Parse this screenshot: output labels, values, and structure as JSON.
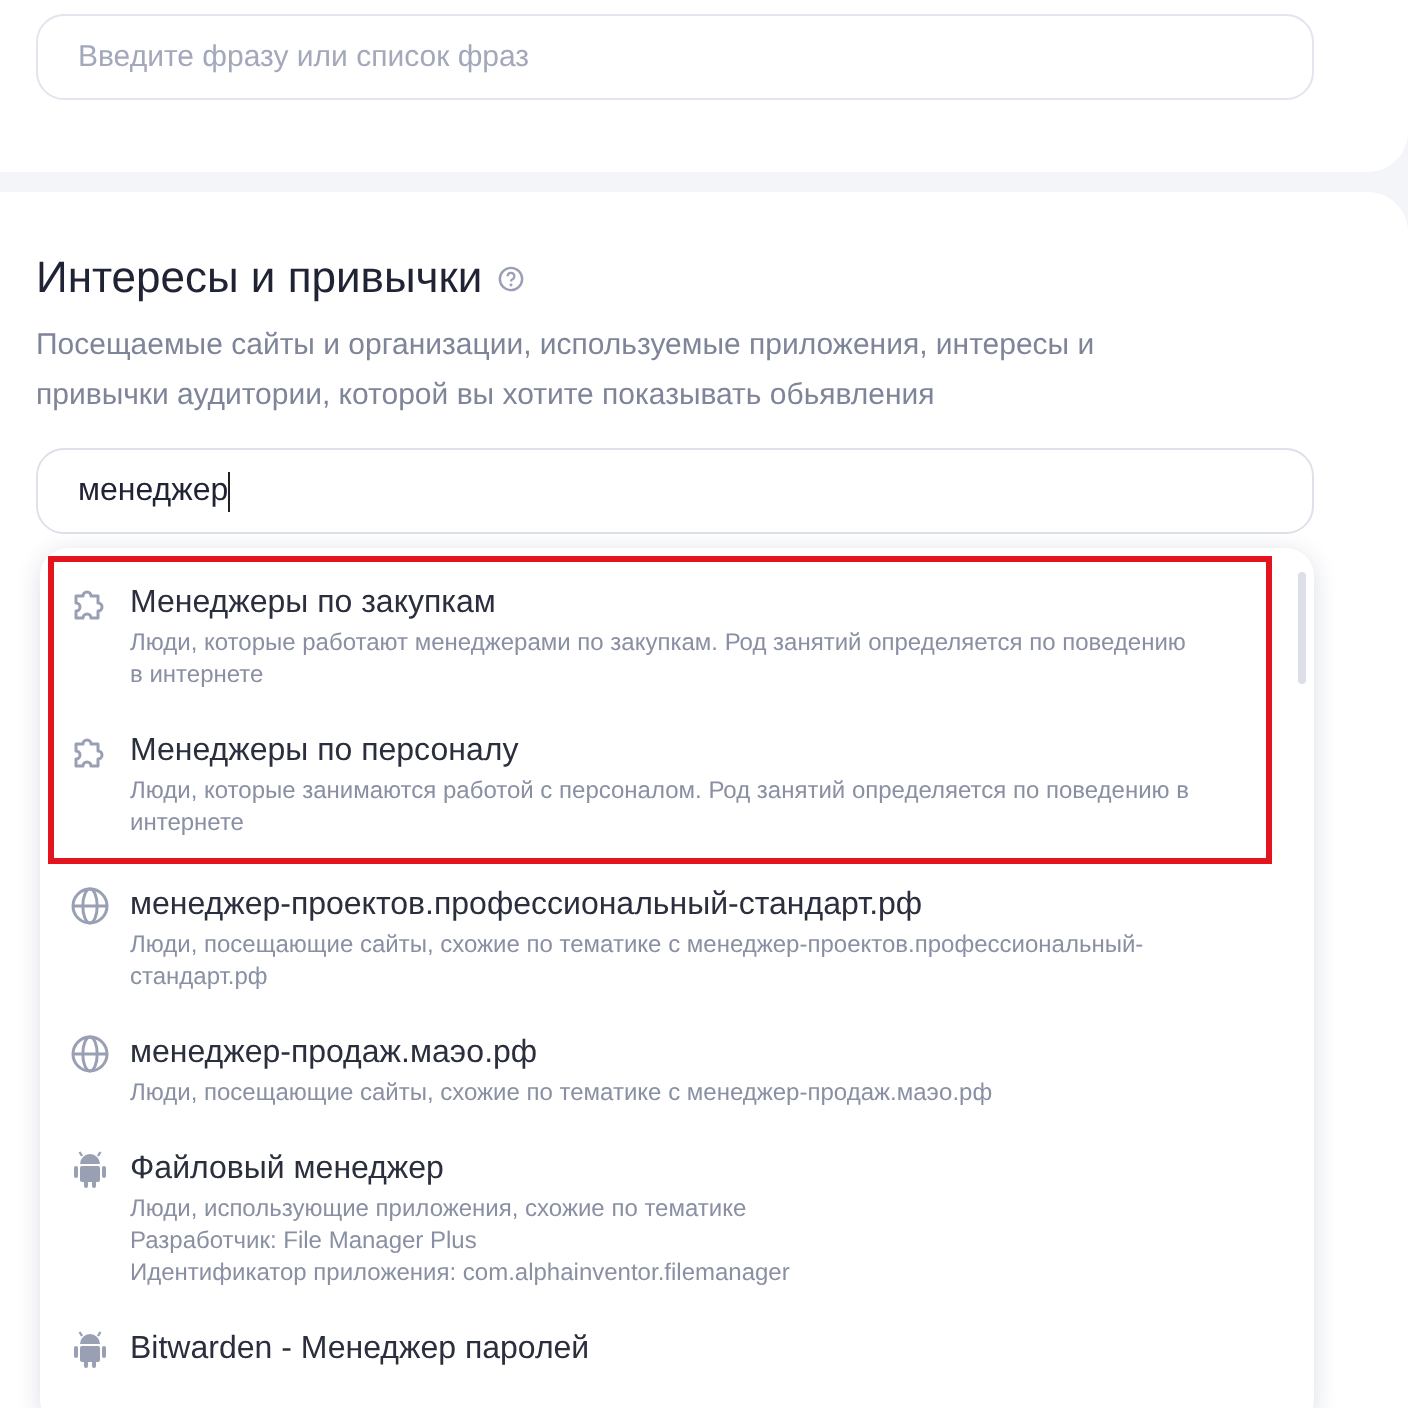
{
  "phrase_field": {
    "placeholder": "Введите фразу или список фраз"
  },
  "interests": {
    "title": "Интересы и привычки",
    "description": "Посещаемые сайты и организации, используемые приложения, интересы и привычки аудитории, которой вы хотите показывать обьявления",
    "search": {
      "value": "менеджер"
    },
    "suggestions": [
      {
        "kind": "interest",
        "highlighted": true,
        "title": "Менеджеры по закупкам",
        "lines": [
          "Люди, которые работают менеджерами по закупкам. Род занятий определяется по поведению в интернете"
        ]
      },
      {
        "kind": "interest",
        "highlighted": true,
        "title": "Менеджеры по персоналу",
        "lines": [
          "Люди, которые занимаются работой с персоналом. Род занятий определяется по поведению в интернете"
        ]
      },
      {
        "kind": "site",
        "highlighted": false,
        "title": "менеджер-проектов.профессиональный-стандарт.рф",
        "lines": [
          "Люди, посещающие сайты, схожие по тематике с менеджер-проектов.профессиональный-стандарт.рф"
        ]
      },
      {
        "kind": "site",
        "highlighted": false,
        "title": "менеджер-продаж.маэо.рф",
        "lines": [
          "Люди, посещающие сайты, схожие по тематике с менеджер-продаж.маэо.рф"
        ]
      },
      {
        "kind": "app",
        "highlighted": false,
        "title": "Файловый менеджер",
        "lines": [
          "Люди, использующие приложения, схожие по тематике",
          "Разработчик: File Manager Plus",
          "Идентификатор приложения: com.alphainventor.filemanager"
        ]
      },
      {
        "kind": "app",
        "highlighted": false,
        "title": "Bitwarden - Менеджер паролей"
      }
    ]
  }
}
